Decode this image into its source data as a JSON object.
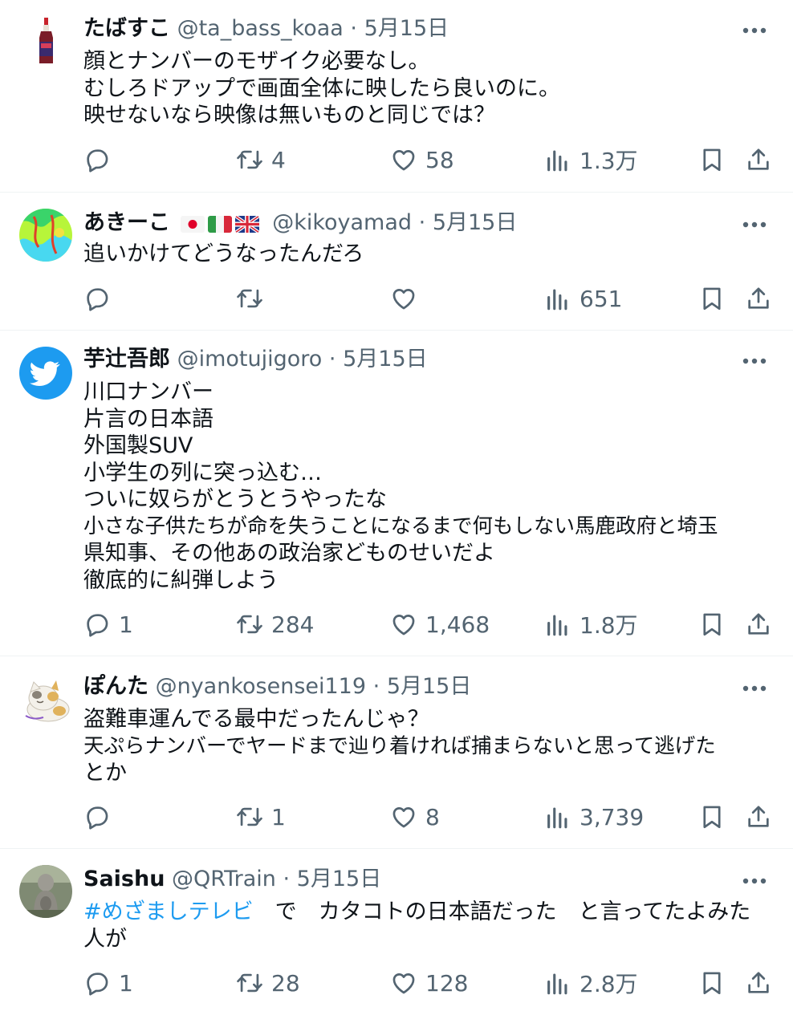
{
  "tweets": [
    {
      "name": "たばすこ",
      "handle": "@ta_bass_koaa",
      "date": "5月15日",
      "lines": [
        "顔とナンバーのモザイク必要なし。",
        "むしろドアップで画面全体に映したら良いのに。",
        "映せないなら映像は無いものと同じでは？"
      ],
      "replies": "",
      "retweets": "4",
      "likes": "58",
      "views": "1.3万"
    },
    {
      "name": "あきーこ",
      "handle": "@kikoyamad",
      "date": "5月15日",
      "lines": [
        "追いかけてどうなったんだろ"
      ],
      "replies": "",
      "retweets": "",
      "likes": "",
      "views": "651"
    },
    {
      "name": "芋辻吾郎",
      "handle": "@imotujigoro",
      "date": "5月15日",
      "lines": [
        "川口ナンバー",
        "片言の日本語",
        "外国製SUV",
        "小学生の列に突っ込む…",
        "ついに奴らがとうとうやったな",
        "小さな子供たちが命を失うことになるまで何もしない馬鹿政府と埼玉",
        "県知事、その他あの政治家どものせいだよ",
        "徹底的に糾弾しよう"
      ],
      "replies": "1",
      "retweets": "284",
      "likes": "1,468",
      "views": "1.8万"
    },
    {
      "name": "ぽんた",
      "handle": "@nyankosensei119",
      "date": "5月15日",
      "lines": [
        "盗難車運んでる最中だったんじゃ？",
        "天ぷらナンバーでヤードまで辿り着ければ捕まらないと思って逃げた",
        "とか"
      ],
      "replies": "",
      "retweets": "1",
      "likes": "8",
      "views": "3,739"
    },
    {
      "name": "Saishu",
      "handle": "@QRTrain",
      "date": "5月15日",
      "hashtag": "#めざましテレビ",
      "line1_rest": "　で　カタコトの日本語だった　と言ってたよみた",
      "line2": "人が",
      "replies": "1",
      "retweets": "28",
      "likes": "128",
      "views": "2.8万"
    }
  ],
  "separator": "·",
  "colors": {
    "text": "#0f1419",
    "muted": "#536471",
    "link": "#1d9bf0",
    "divider": "#eff3f4"
  }
}
